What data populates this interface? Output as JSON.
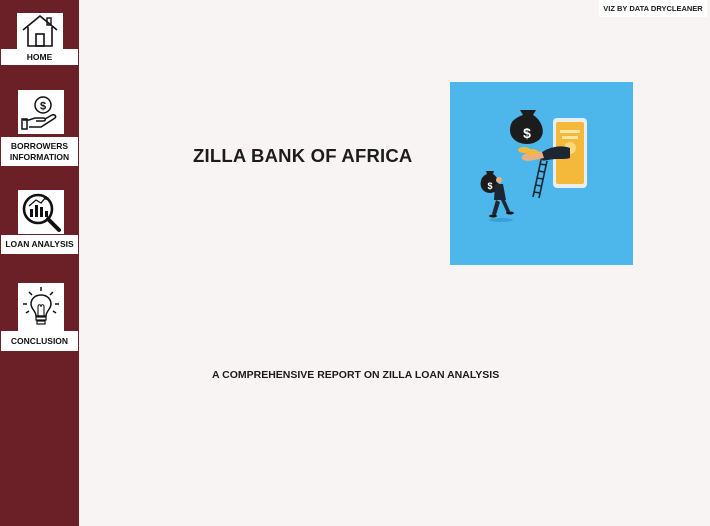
{
  "credit": "VIZ BY DATA DRYCLEANER",
  "title": "ZILLA BANK OF AFRICA",
  "subtitle": "A COMPREHENSIVE REPORT ON ZILLA LOAN ANALYSIS",
  "hero_sign": "$",
  "nav": {
    "home": {
      "line1": "HOME",
      "icon": "house-icon"
    },
    "borrowers": {
      "line1": "BORROWERS",
      "line2": "INFORMATION",
      "icon": "hand-coin-icon"
    },
    "loan": {
      "line1": "LOAN ANALYSIS",
      "icon": "magnifier-chart-icon"
    },
    "conclusion": {
      "line1": "CONCLUSION",
      "icon": "lightbulb-icon"
    }
  },
  "colors": {
    "sidebar": "#6b2027",
    "background": "#f8f4f3",
    "hero_bg": "#4db6ea",
    "text": "#1c1c1c"
  }
}
